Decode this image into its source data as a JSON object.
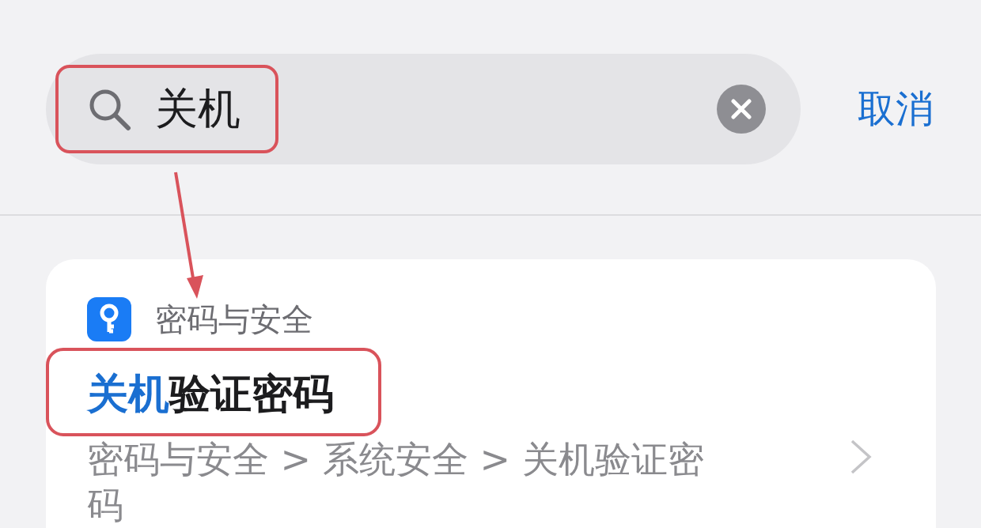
{
  "search": {
    "value": "关机",
    "highlighted": true,
    "cancel": "取消"
  },
  "annotation_arrow": true,
  "result": {
    "section": "密码与安全",
    "highlighted": true,
    "title": [
      {
        "text": "关机",
        "match": true
      },
      {
        "text": "验证密码",
        "match": false
      }
    ],
    "path": "密码与安全 > 系统安全 > 关机验证密码"
  }
}
